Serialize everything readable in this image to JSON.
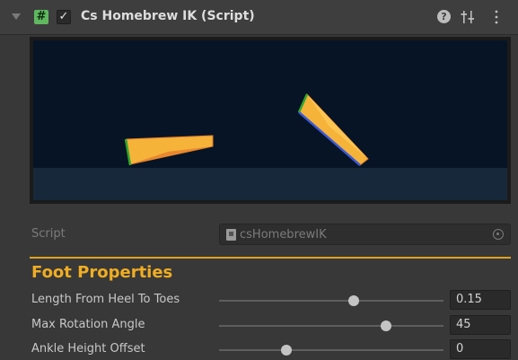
{
  "component": {
    "title": "Cs Homebrew IK (Script)",
    "script_icon_glyph": "#",
    "enabled_glyph": "✓",
    "enabled": true,
    "help_glyph": "?"
  },
  "script_field": {
    "label": "Script",
    "value": "csHomebrewIK"
  },
  "section": {
    "title": "Foot Properties"
  },
  "sliders": [
    {
      "label": "Length From Heel To Toes",
      "value": "0.15",
      "fraction": 0.6
    },
    {
      "label": "Max Rotation Angle",
      "value": "45",
      "fraction": 0.745
    },
    {
      "label": "Ankle Height Offset",
      "value": "0",
      "fraction": 0.3
    }
  ],
  "colors": {
    "accent": "#f0ad23",
    "foot_fill": "#f5b33a",
    "foot_edge": "#e07a2b",
    "heel_axis": "#2fa82f",
    "sole_axis": "#3a5ad8",
    "preview_sky": "#061426",
    "preview_ground": "#17283a"
  }
}
